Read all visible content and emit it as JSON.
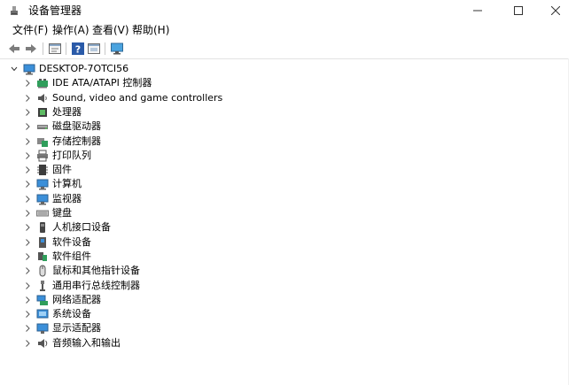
{
  "window": {
    "title": "设备管理器",
    "controls": {
      "minimize": "minimize",
      "maximize": "maximize",
      "close": "close"
    }
  },
  "menu": [
    {
      "label": "文件(F)"
    },
    {
      "label": "操作(A)"
    },
    {
      "label": "查看(V)"
    },
    {
      "label": "帮助(H)"
    }
  ],
  "toolbar": {
    "icons": [
      "back-arrow-icon",
      "forward-arrow-icon",
      "properties-icon",
      "help-icon",
      "view-icon",
      "monitor-scan-icon"
    ]
  },
  "tree": {
    "root": {
      "label": "DESKTOP-7OTCI56",
      "icon": "computer-icon",
      "expanded": true
    },
    "items": [
      {
        "label": "IDE ATA/ATAPI 控制器",
        "icon": "ide-controller-icon"
      },
      {
        "label": "Sound, video and game controllers",
        "icon": "speaker-icon"
      },
      {
        "label": "处理器",
        "icon": "processor-icon"
      },
      {
        "label": "磁盘驱动器",
        "icon": "disk-drive-icon"
      },
      {
        "label": "存储控制器",
        "icon": "storage-controller-icon"
      },
      {
        "label": "打印队列",
        "icon": "printer-icon"
      },
      {
        "label": "固件",
        "icon": "firmware-icon"
      },
      {
        "label": "计算机",
        "icon": "computer-icon"
      },
      {
        "label": "监视器",
        "icon": "monitor-icon"
      },
      {
        "label": "键盘",
        "icon": "keyboard-icon"
      },
      {
        "label": "人机接口设备",
        "icon": "hid-icon"
      },
      {
        "label": "软件设备",
        "icon": "software-device-icon"
      },
      {
        "label": "软件组件",
        "icon": "software-component-icon"
      },
      {
        "label": "鼠标和其他指针设备",
        "icon": "mouse-icon"
      },
      {
        "label": "通用串行总线控制器",
        "icon": "usb-icon"
      },
      {
        "label": "网络适配器",
        "icon": "network-adapter-icon"
      },
      {
        "label": "系统设备",
        "icon": "system-device-icon"
      },
      {
        "label": "显示适配器",
        "icon": "display-adapter-icon"
      },
      {
        "label": "音频输入和输出",
        "icon": "audio-io-icon"
      }
    ]
  },
  "colors": {
    "icon_blue": "#2a7fd4",
    "icon_dark": "#3c3c3c",
    "toolbar_green": "#2e8b57",
    "arrow_gray": "#7d7d7d"
  }
}
